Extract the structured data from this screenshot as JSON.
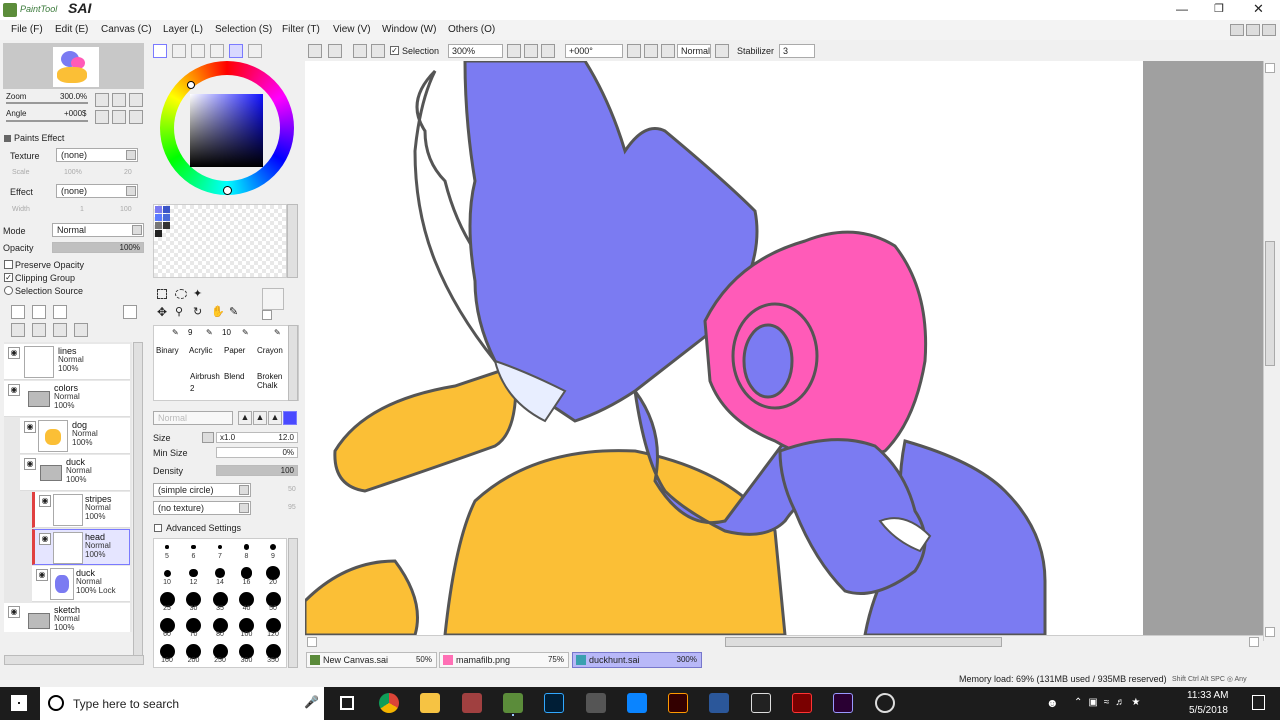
{
  "app": {
    "logo_text": "PaintTool",
    "name": "SAI"
  },
  "menu": [
    "File (F)",
    "Edit (E)",
    "Canvas (C)",
    "Layer (L)",
    "Selection (S)",
    "Filter (T)",
    "View (V)",
    "Window (W)",
    "Others (O)"
  ],
  "toolbar": {
    "selection_label": "Selection",
    "selection_checked": true,
    "zoom": "300%",
    "angle": "+000°",
    "blend_mode": "Normal",
    "stabilizer_label": "Stabilizer",
    "stabilizer_value": "3"
  },
  "navigator": {
    "zoom_label": "Zoom",
    "zoom_value": "300.0%",
    "angle_label": "Angle",
    "angle_value": "+000$"
  },
  "paints_effect": {
    "title": "Paints Effect",
    "texture_label": "Texture",
    "texture_value": "(none)",
    "scale_label": "Scale",
    "scale_value": "100%",
    "scale_num": "20",
    "effect_label": "Effect",
    "effect_value": "(none)",
    "width_label": "Width",
    "width_value": "1",
    "width_num": "100"
  },
  "layer_props": {
    "mode_label": "Mode",
    "mode_value": "Normal",
    "opacity_label": "Opacity",
    "opacity_value": "100%",
    "opacity_fraction": 1.0,
    "preserve_opacity": "Preserve Opacity",
    "clipping_group": "Clipping Group",
    "selection_source": "Selection Source"
  },
  "layers": [
    {
      "name": "lines",
      "mode": "Normal",
      "opacity": "100%",
      "indent": 0,
      "type": "layer",
      "selected": false
    },
    {
      "name": "colors",
      "mode": "Normal",
      "opacity": "100%",
      "indent": 0,
      "type": "folder",
      "selected": false
    },
    {
      "name": "dog",
      "mode": "Normal",
      "opacity": "100%",
      "indent": 1,
      "type": "layer",
      "selected": false
    },
    {
      "name": "duck",
      "mode": "Normal",
      "opacity": "100%",
      "indent": 1,
      "type": "folder",
      "selected": false
    },
    {
      "name": "stripes",
      "mode": "Normal",
      "opacity": "100%",
      "indent": 2,
      "type": "layer",
      "selected": false
    },
    {
      "name": "head",
      "mode": "Normal",
      "opacity": "100%",
      "indent": 2,
      "type": "layer",
      "selected": true
    },
    {
      "name": "duck",
      "mode": "Normal",
      "opacity": "100% Lock",
      "indent": 2,
      "type": "layer",
      "selected": false
    },
    {
      "name": "sketch",
      "mode": "Normal",
      "opacity": "100%",
      "indent": 0,
      "type": "folder",
      "selected": false
    }
  ],
  "brushes": {
    "sizes_row": [
      "9",
      "10"
    ],
    "row1": [
      "Binary",
      "Acrylic",
      "Paper",
      "Crayon"
    ],
    "row2": [
      "Airbrush",
      "Blend",
      "Broken Chalk"
    ],
    "airbrush_size": "2",
    "mode": "Normal"
  },
  "brush_settings": {
    "size_label": "Size",
    "size_mult": "x1.0",
    "size_value": "12.0",
    "min_size_label": "Min Size",
    "min_size_value": "0%",
    "density_label": "Density",
    "density_value": "100",
    "shape": "(simple circle)",
    "shape_num": "50",
    "texture": "(no texture)",
    "texture_num": "95",
    "advanced": "Advanced Settings"
  },
  "brush_sizes": [
    "5",
    "6",
    "7",
    "8",
    "9",
    "10",
    "12",
    "14",
    "16",
    "20",
    "25",
    "30",
    "35",
    "40",
    "50",
    "60",
    "70",
    "80",
    "100",
    "120",
    "160",
    "200",
    "250",
    "300",
    "350"
  ],
  "tabs": [
    {
      "name": "New Canvas.sai",
      "zoom": "50%",
      "active": false
    },
    {
      "name": "mamafilb.png",
      "zoom": "75%",
      "active": false
    },
    {
      "name": "duckhunt.sai",
      "zoom": "300%",
      "active": true
    }
  ],
  "status": {
    "memory": "Memory load: 69% (131MB used / 935MB reserved)",
    "keys": "Shift Ctrl Alt SPC ◎ Any"
  },
  "taskbar": {
    "search_placeholder": "Type here to search",
    "time": "11:33 AM",
    "date": "5/5/2018"
  },
  "colors": {
    "accent": "#7a7aff",
    "duck_blue": "#7b7bf2",
    "pink": "#ff5bb8",
    "yellow": "#fbbf36"
  }
}
